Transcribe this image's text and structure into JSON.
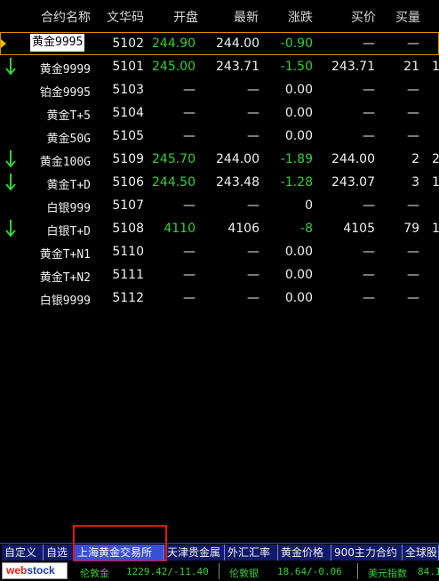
{
  "header": {
    "name": "合约名称",
    "code": "文华码",
    "open": "开盘",
    "latest": "最新",
    "change": "涨跌",
    "bid": "买价",
    "qty": "买量"
  },
  "rows": [
    {
      "name": "黄金9995",
      "code": "5102",
      "open": "244.90",
      "latest": "244.00",
      "change": "-0.90",
      "bid": "—",
      "qty": "—",
      "cut": "",
      "arrow": false
    },
    {
      "name": "黄金9999",
      "code": "5101",
      "open": "245.00",
      "latest": "243.71",
      "change": "-1.50",
      "bid": "243.71",
      "qty": "21",
      "cut": "1",
      "arrow": true
    },
    {
      "name": "铂金9995",
      "code": "5103",
      "open": "—",
      "latest": "—",
      "change": "0.00",
      "bid": "—",
      "qty": "—",
      "cut": "",
      "arrow": false
    },
    {
      "name": "黄金T+5",
      "code": "5104",
      "open": "—",
      "latest": "—",
      "change": "0.00",
      "bid": "—",
      "qty": "—",
      "cut": "",
      "arrow": false
    },
    {
      "name": "黄金50G",
      "code": "5105",
      "open": "—",
      "latest": "—",
      "change": "0.00",
      "bid": "—",
      "qty": "—",
      "cut": "",
      "arrow": false
    },
    {
      "name": "黄金100G",
      "code": "5109",
      "open": "245.70",
      "latest": "244.00",
      "change": "-1.89",
      "bid": "244.00",
      "qty": "2",
      "cut": "2",
      "arrow": true
    },
    {
      "name": "黄金T+D",
      "code": "5106",
      "open": "244.50",
      "latest": "243.48",
      "change": "-1.28",
      "bid": "243.07",
      "qty": "3",
      "cut": "1",
      "arrow": true
    },
    {
      "name": "白银999",
      "code": "5107",
      "open": "—",
      "latest": "—",
      "change": "0",
      "bid": "—",
      "qty": "—",
      "cut": "",
      "arrow": false
    },
    {
      "name": "白银T+D",
      "code": "5108",
      "open": "4110",
      "latest": "4106",
      "change": "-8",
      "bid": "4105",
      "qty": "79",
      "cut": "1",
      "arrow": true
    },
    {
      "name": "黄金T+N1",
      "code": "5110",
      "open": "—",
      "latest": "—",
      "change": "0.00",
      "bid": "—",
      "qty": "—",
      "cut": "",
      "arrow": false
    },
    {
      "name": "黄金T+N2",
      "code": "5111",
      "open": "—",
      "latest": "—",
      "change": "0.00",
      "bid": "—",
      "qty": "—",
      "cut": "",
      "arrow": false
    },
    {
      "name": "白银9999",
      "code": "5112",
      "open": "—",
      "latest": "—",
      "change": "0.00",
      "bid": "—",
      "qty": "—",
      "cut": "",
      "arrow": false
    }
  ],
  "tabs": [
    "自定义",
    "自选",
    "上海黄金交易所",
    "天津贵金属",
    "外汇汇率",
    "黄金价格",
    "900主力合约",
    "全球股"
  ],
  "active_tab": 2,
  "ticker": {
    "logo_a": "web",
    "logo_b": "stock",
    "items": [
      {
        "label": "伦敦金",
        "value": "1229.42/-11.40"
      },
      {
        "label": "伦敦银",
        "value": "18.64/-0.06"
      },
      {
        "label": "美元指数",
        "value": "84.1"
      }
    ]
  },
  "colors": {
    "up": "#33d033",
    "down_arrow": "#33d033",
    "highlight": "#e11111",
    "tab_active": "#3b4fd6",
    "tab": "#101a6a"
  }
}
